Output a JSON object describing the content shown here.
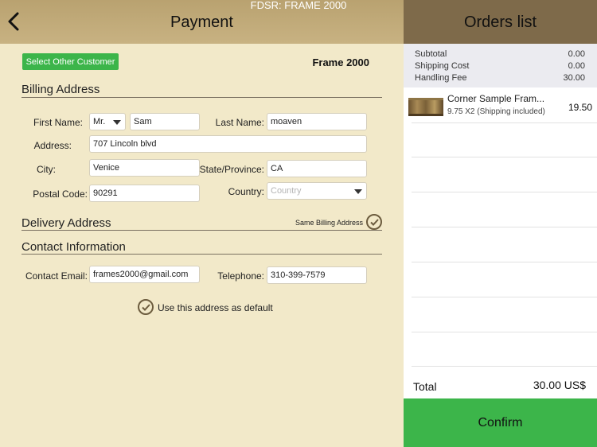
{
  "status_bar": {
    "title": "FDSR: FRAME 2000"
  },
  "payment": {
    "title": "Payment",
    "select_customer_label": "Select Other Customer",
    "store_name": "Frame 2000",
    "billing": {
      "title": "Billing Address",
      "first_name_label": "First Name:",
      "salutation": "Mr.",
      "first_name": "Sam",
      "last_name_label": "Last Name:",
      "last_name": "moaven",
      "address_label": "Address:",
      "address": "707 Lincoln blvd",
      "city_label": "City:",
      "city": "Venice",
      "state_label": "State/Province:",
      "state": "CA",
      "postal_label": "Postal Code:",
      "postal": "90291",
      "country_label": "Country:",
      "country_placeholder": "Country"
    },
    "delivery": {
      "title": "Delivery Address",
      "same_billing_label": "Same Billing Address"
    },
    "contact": {
      "title": "Contact Information",
      "email_label": "Contact Email:",
      "email": "frames2000@gmail.com",
      "phone_label": "Telephone:",
      "phone": "310-399-7579"
    },
    "default_label": "Use this address as default"
  },
  "orders": {
    "title": "Orders list",
    "summary": [
      {
        "label": "Subtotal",
        "value": "0.00"
      },
      {
        "label": "Shipping Cost",
        "value": "0.00"
      },
      {
        "label": "Handling Fee",
        "value": "30.00"
      }
    ],
    "items": [
      {
        "name": "Corner Sample Fram...",
        "detail": "9.75 X2 (Shipping included)",
        "price": "19.50"
      }
    ],
    "total_label": "Total",
    "total_value": "30.00 US$",
    "confirm_label": "Confirm"
  },
  "colors": {
    "accent_green": "#3cb54a",
    "header_tan": "#c8b282",
    "header_brown": "#7e6a4a",
    "background_cream": "#f2e9c9"
  }
}
